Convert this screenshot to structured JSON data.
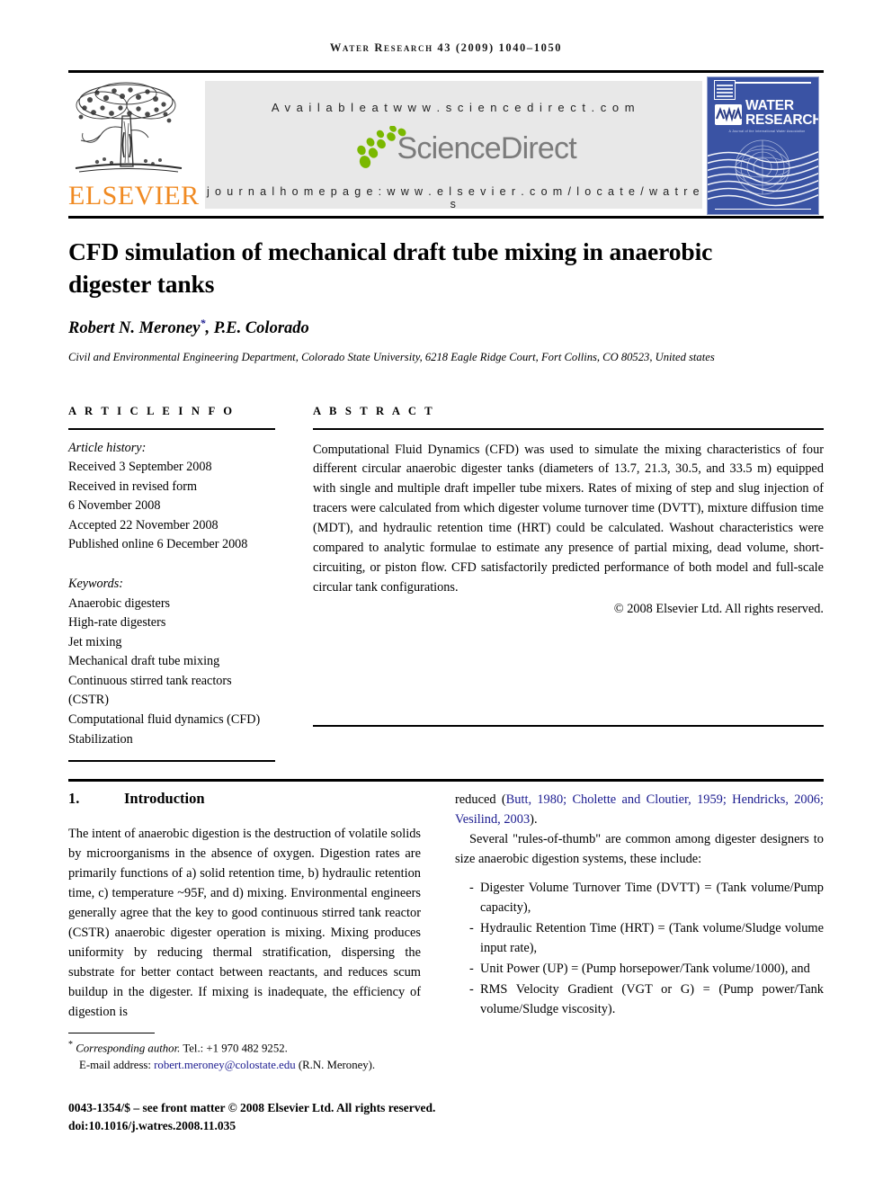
{
  "running_head": "Water Research 43 (2009) 1040–1050",
  "masthead": {
    "publisher_name": "ELSEVIER",
    "tree_icon": "elsevier-tree-icon",
    "available_at": "A v a i l a b l e   a t   w w w . s c i e n c e d i r e c t . c o m",
    "sciencedirect_wordmark": "ScienceDirect",
    "sciencedirect_leaf_icon": "sciencedirect-leaves-icon",
    "journal_homepage": "j o u r n a l   h o m e p a g e :   w w w . e l s e v i e r . c o m / l o c a t e / w a t r e s",
    "cover": {
      "title_line1": "WATER",
      "title_line2": "RESEARCH",
      "iwa_logo": "IWA",
      "subtitle": "A Journal of the International Water Association",
      "background_color": "#3a53a4"
    }
  },
  "article": {
    "title": "CFD simulation of mechanical draft tube mixing in anaerobic digester tanks",
    "author": "Robert N. Meroney",
    "author_suffix": ", P.E. Colorado",
    "affiliation": "Civil and Environmental Engineering Department, Colorado State University, 6218 Eagle Ridge Court, Fort Collins, CO 80523, United states"
  },
  "article_info": {
    "label": "A R T I C L E   I N F O",
    "history_label": "Article history:",
    "history": [
      "Received 3 September 2008",
      "Received in revised form",
      "6 November 2008",
      "Accepted 22 November 2008",
      "Published online 6 December 2008"
    ],
    "keywords_label": "Keywords:",
    "keywords": [
      "Anaerobic digesters",
      "High-rate digesters",
      "Jet mixing",
      "Mechanical draft tube mixing",
      "Continuous stirred tank reactors",
      "(CSTR)",
      "Computational fluid dynamics (CFD)",
      "Stabilization"
    ]
  },
  "abstract": {
    "label": "A B S T R A C T",
    "text": "Computational Fluid Dynamics (CFD) was used to simulate the mixing characteristics of four different circular anaerobic digester tanks (diameters of 13.7, 21.3, 30.5, and 33.5 m) equipped with single and multiple draft impeller tube mixers. Rates of mixing of step and slug injection of tracers were calculated from which digester volume turnover time (DVTT), mixture diffusion time (MDT), and hydraulic retention time (HRT) could be calculated. Washout characteristics were compared to analytic formulae to estimate any presence of partial mixing, dead volume, short-circuiting, or piston flow. CFD satisfactorily predicted performance of both model and full-scale circular tank configurations.",
    "copyright": "© 2008 Elsevier Ltd. All rights reserved."
  },
  "introduction": {
    "number": "1.",
    "heading": "Introduction",
    "paragraph1": "The intent of anaerobic digestion is the destruction of volatile solids by microorganisms in the absence of oxygen. Digestion rates are primarily functions of a) solid retention time, b) hydraulic retention time, c) temperature ~95F, and d) mixing. Environmental engineers generally agree that the key to good continuous stirred tank reactor (CSTR) anaerobic digester operation is mixing. Mixing produces uniformity by reducing thermal stratification, dispersing the substrate for better contact between reactants, and reduces scum buildup in the digester. If mixing is inadequate, the efficiency of digestion is",
    "paragraph1_cont_prefix": "reduced (",
    "citations": "Butt, 1980; Cholette and Cloutier, 1959; Hendricks, 2006; Vesilind, 2003",
    "paragraph1_cont_suffix": ").",
    "paragraph2": "Several \"rules-of-thumb\" are common among digester designers to size anaerobic digestion systems, these include:",
    "rules": [
      "Digester Volume Turnover Time (DVTT) = (Tank volume/Pump capacity),",
      "Hydraulic Retention Time (HRT) = (Tank volume/Sludge volume input rate),",
      "Unit Power (UP) = (Pump horsepower/Tank volume/1000), and",
      "RMS Velocity Gradient (VGT or G) = (Pump power/Tank volume/Sludge viscosity)."
    ]
  },
  "footnote": {
    "marker": "*",
    "corresponding_label": "Corresponding author.",
    "tel": "Tel.: +1 970 482 9252.",
    "email_label": "E-mail address:",
    "email": "robert.meroney@colostate.edu",
    "email_owner": "(R.N. Meroney)."
  },
  "footer": {
    "issn_line": "0043-1354/$ – see front matter © 2008 Elsevier Ltd. All rights reserved.",
    "doi_line": "doi:10.1016/j.watres.2008.11.035"
  },
  "colors": {
    "elsevier_orange": "#F08A22",
    "link_blue": "#1b1b8f",
    "cover_blue": "#3a53a4",
    "banner_gray": "#e8e8e8",
    "sciencedirect_green": "#7ab800"
  }
}
